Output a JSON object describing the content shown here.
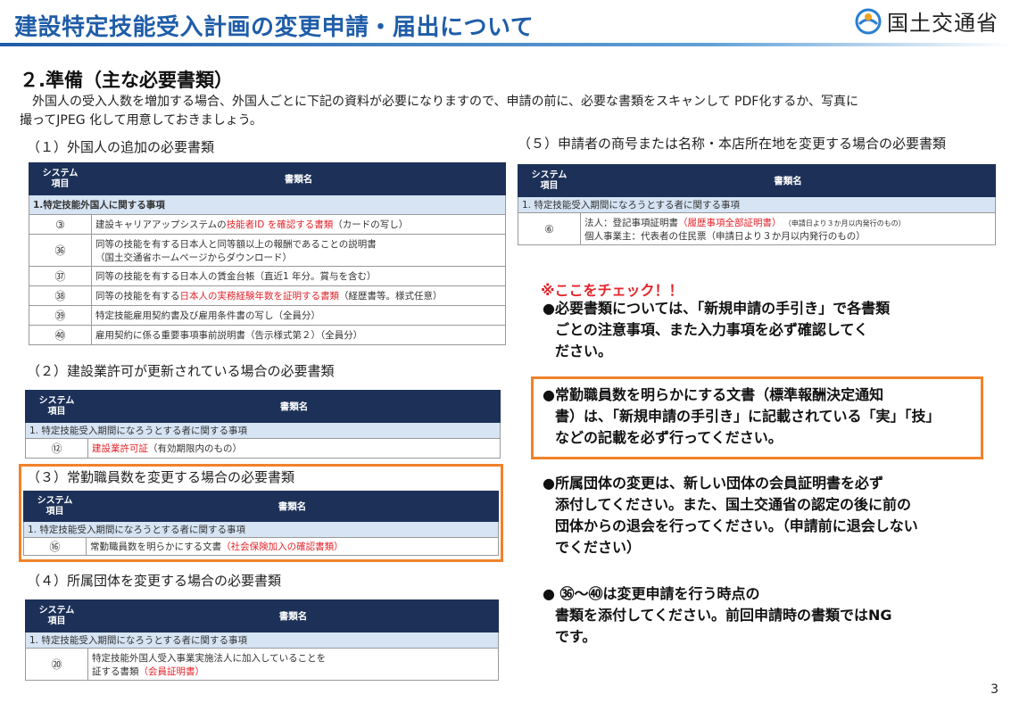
{
  "header": {
    "title": "建設特定技能受入計画の変更申請・届出について",
    "logo_text": "国土交通省"
  },
  "section": {
    "title": "２.準備（主な必要書類）",
    "intro_line1": "外国人の受入人数を増加する場合、外国人ごとに下記の資料が必要になりますので、申請の前に、必要な書類をスキャンして PDF化するか、写真に",
    "intro_line2": "撮ってJPEG 化して用意しておきましょう。"
  },
  "col_headers": {
    "system": "システム",
    "system2": "項目",
    "doc_name": "書類名"
  },
  "t1": {
    "heading": "（１）外国人の追加の必要書類",
    "group": "1.特定技能外国人に関する事項",
    "rows": [
      {
        "num": "③",
        "a": "建設キャリアアップシステムの",
        "b": "技能者ID を確認する書類",
        "c": "（カードの写し）"
      },
      {
        "num": "㊱",
        "a": "同等の技能を有する日本人と同等額以上の報酬であることの説明書",
        "b": "（国土交通省ホームページからダウンロード）"
      },
      {
        "num": "㊲",
        "a": "同等の技能を有する日本人の賃金台帳（直近1 年分。賞与を含む）"
      },
      {
        "num": "㊳",
        "a": "同等の技能を有する",
        "b": "日本人の実務経験年数を証明する書類",
        "c": "（経歴書等。様式任意）"
      },
      {
        "num": "㊴",
        "a": "特定技能雇用契約書及び雇用条件書の写し（全員分）"
      },
      {
        "num": "㊵",
        "a": "雇用契約に係る重要事項事前説明書（告示様式第２）（全員分）"
      }
    ]
  },
  "t2": {
    "heading": "（２）建設業許可が更新されている場合の必要書類",
    "group": "1. 特定技能受入期間になろうとする者に関する事項",
    "num": "⑫",
    "a": "建設業許可証",
    "b": "（有効期限内のもの）"
  },
  "t3": {
    "heading": "（３）常勤職員数を変更する場合の必要書類",
    "group": "1. 特定技能受入期間になろうとする者に関する事項",
    "num": "⑯",
    "a": "常勤職員数を明らかにする文書",
    "b": "（社会保険加入の確認書類）"
  },
  "t4": {
    "heading": "（４）所属団体を変更する場合の必要書類",
    "group": "1. 特定技能受入期間になろうとする者に関する事項",
    "num": "⑳",
    "a": "特定技能外国人受入事業実施法人に加入していることを",
    "b": "証する書類",
    "c": "（会員証明書）"
  },
  "t5": {
    "heading": "（５）申請者の商号または名称・本店所在地を変更する場合の必要書類",
    "group": "1. 特定技能受入期間になろうとする者に関する事項",
    "num": "⑥",
    "a": "法人：登記事項証明書",
    "b": "（履歴事項全部証明書）",
    "c": "（申請日より３か月以内発行のもの）",
    "d": "個人事業主：代表者の住民票（申請日より３か月以内発行のもの）"
  },
  "check": {
    "title": "※ここをチェック！！",
    "b1": [
      "●必要書類については、「新規申請の手引き」で各書類",
      "ごとの注意事項、また入力事項を必ず確認してく",
      "ださい。"
    ],
    "b2": [
      "●常勤職員数を明らかにする文書（標準報酬決定通知",
      "書）は、「新規申請の手引き」に記載されている「実」「技」",
      "などの記載を必ず行ってください。"
    ],
    "b3": [
      "●所属団体の変更は、新しい団体の会員証明書を必ず",
      "添付してください。また、国土交通省の認定の後に前の",
      "団体からの退会を行ってください。（申請前に退会しない",
      "でください）"
    ],
    "b4": [
      "● ㊱～㊵は変更申請を行う時点の",
      "書類を添付してください。前回申請時の書類ではNG",
      "です。"
    ]
  },
  "page_number": "3",
  "colors": {
    "title": "#1f5da8",
    "header_cell": "#1d3158",
    "group_row": "#d6e4f4",
    "highlight": "#f0822a",
    "red": "#e3242b"
  }
}
